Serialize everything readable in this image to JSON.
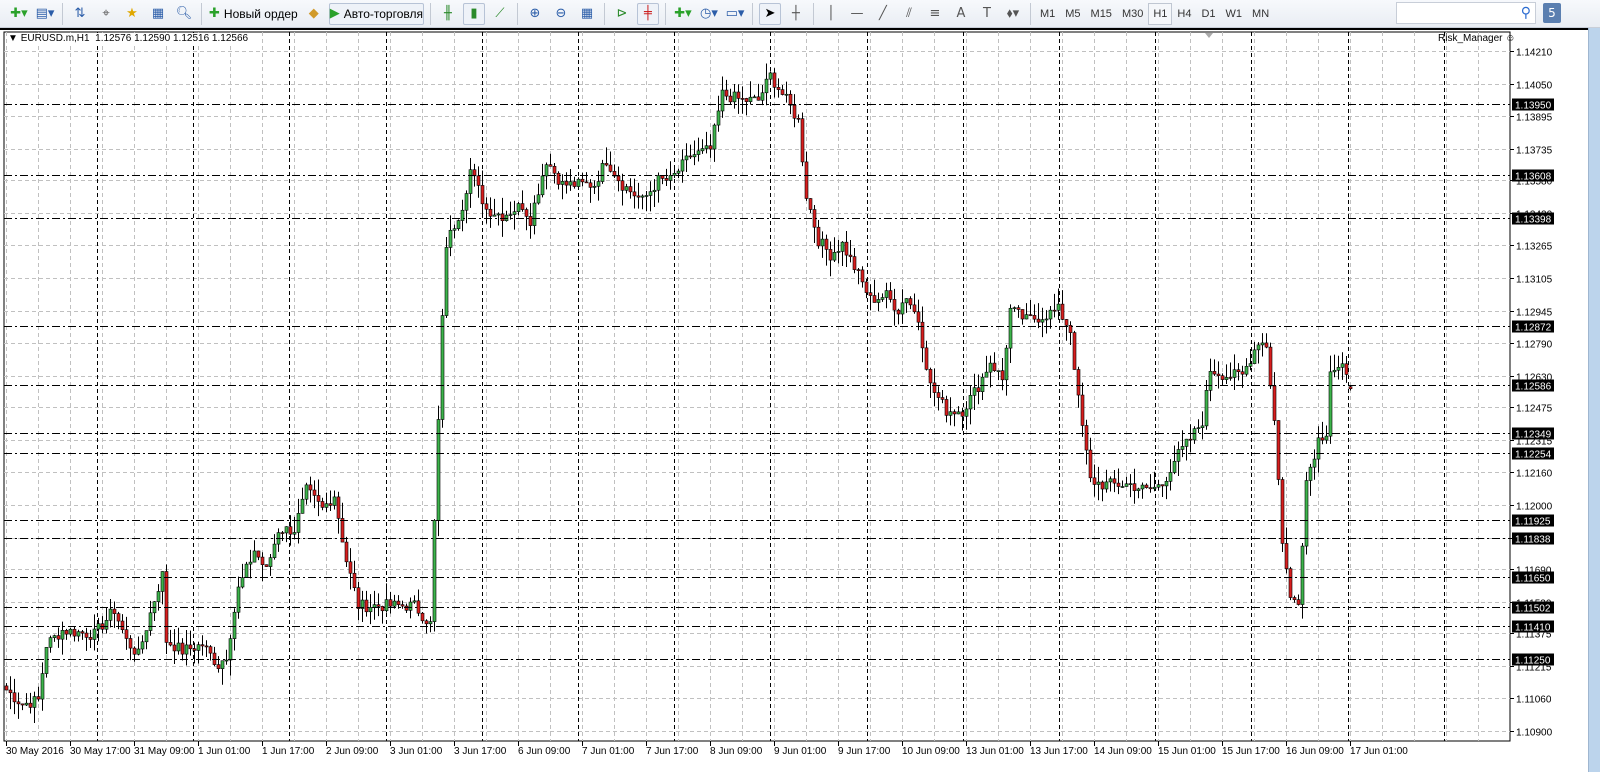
{
  "toolbar": {
    "new_order_label": "Новый ордер",
    "autotrading_label": "Авто-торговля",
    "icons": [
      "new-chart-icon",
      "profiles-icon",
      "market-watch-icon",
      "navigator-crosshair-icon",
      "favorites-icon",
      "terminal-icon",
      "strategy-tester-icon",
      "new-order-icon",
      "metaeditor-icon",
      "autotrading-icon",
      "bar-chart-icon",
      "candlestick-icon",
      "line-chart-icon",
      "zoom-in-icon",
      "zoom-out-icon",
      "tile-windows-icon",
      "chart-shift-icon",
      "autoscroll-icon",
      "indicators-icon",
      "periods-icon",
      "templates-icon",
      "cursor-icon",
      "crosshair-icon",
      "vertical-line-icon",
      "horizontal-line-icon",
      "trendline-icon",
      "equidistant-channel-icon",
      "fibonacci-icon",
      "text-icon",
      "text-label-icon",
      "arrows-icon"
    ],
    "timeframes": [
      "M1",
      "M5",
      "M15",
      "M30",
      "H1",
      "H4",
      "D1",
      "W1",
      "MN"
    ],
    "active_timeframe": "H1",
    "notification_count": "5"
  },
  "chart": {
    "symbol_line": "EURUSD.m,H1  1.12576 1.12590 1.12516 1.12566",
    "expert_label": "Risk_Manager",
    "colors": {
      "bull": "#3cb44b",
      "bear": "#d81e1e",
      "grid": "#c0c0c0",
      "level": "#000000"
    }
  },
  "chart_data": {
    "type": "candlestick",
    "symbol": "EURUSD.m",
    "timeframe": "H1",
    "ylim": [
      1.109,
      1.1421
    ],
    "y_ticks": [
      "1.14210",
      "1.14050",
      "1.13895",
      "1.13735",
      "1.13580",
      "1.13420",
      "1.13265",
      "1.13105",
      "1.12945",
      "1.12790",
      "1.12630",
      "1.12475",
      "1.12315",
      "1.12160",
      "1.12000",
      "1.11840",
      "1.11690",
      "1.11530",
      "1.11375",
      "1.11215",
      "1.11060",
      "1.10900"
    ],
    "levels": [
      "1.13950",
      "1.13608",
      "1.13398",
      "1.12872",
      "1.12586",
      "1.12349",
      "1.12254",
      "1.11925",
      "1.11838",
      "1.11650",
      "1.11502",
      "1.11410",
      "1.11250"
    ],
    "x_labels": [
      "30 May 2016",
      "30 May 17:00",
      "31 May 09:00",
      "1 Jun 01:00",
      "1 Jun 17:00",
      "2 Jun 09:00",
      "3 Jun 01:00",
      "3 Jun 17:00",
      "6 Jun 09:00",
      "7 Jun 01:00",
      "7 Jun 17:00",
      "8 Jun 09:00",
      "9 Jun 01:00",
      "9 Jun 17:00",
      "10 Jun 09:00",
      "13 Jun 01:00",
      "13 Jun 17:00",
      "14 Jun 09:00",
      "15 Jun 01:00",
      "15 Jun 17:00",
      "16 Jun 09:00",
      "17 Jun 01:00"
    ],
    "last_ohlc": {
      "open": 1.12576,
      "high": 1.1259,
      "low": 1.12516,
      "close": 1.12566
    },
    "close_path": [
      [
        0,
        1.111
      ],
      [
        4,
        1.1103
      ],
      [
        8,
        1.1105
      ],
      [
        10,
        1.1132
      ],
      [
        14,
        1.1139
      ],
      [
        22,
        1.1137
      ],
      [
        27,
        1.1149
      ],
      [
        30,
        1.1134
      ],
      [
        33,
        1.1127
      ],
      [
        37,
        1.1154
      ],
      [
        39,
        1.1166
      ],
      [
        40,
        1.1134
      ],
      [
        44,
        1.1129
      ],
      [
        49,
        1.1132
      ],
      [
        53,
        1.1122
      ],
      [
        55,
        1.1127
      ],
      [
        58,
        1.1159
      ],
      [
        62,
        1.1178
      ],
      [
        65,
        1.1168
      ],
      [
        68,
        1.1188
      ],
      [
        72,
        1.1188
      ],
      [
        75,
        1.1207
      ],
      [
        79,
        1.1198
      ],
      [
        82,
        1.1205
      ],
      [
        85,
        1.1173
      ],
      [
        88,
        1.1151
      ],
      [
        93,
        1.1151
      ],
      [
        98,
        1.1151
      ],
      [
        102,
        1.1151
      ],
      [
        106,
        1.1142
      ],
      [
        109,
        1.129
      ],
      [
        110,
        1.1327
      ],
      [
        114,
        1.1346
      ],
      [
        116,
        1.1363
      ],
      [
        120,
        1.1344
      ],
      [
        124,
        1.1341
      ],
      [
        129,
        1.1346
      ],
      [
        131,
        1.1339
      ],
      [
        135,
        1.1368
      ],
      [
        139,
        1.1356
      ],
      [
        143,
        1.1356
      ],
      [
        147,
        1.1356
      ],
      [
        150,
        1.1368
      ],
      [
        154,
        1.1356
      ],
      [
        159,
        1.1348
      ],
      [
        163,
        1.1358
      ],
      [
        166,
        1.1358
      ],
      [
        171,
        1.137
      ],
      [
        176,
        1.1373
      ],
      [
        179,
        1.14
      ],
      [
        184,
        1.1397
      ],
      [
        188,
        1.1397
      ],
      [
        191,
        1.1409
      ],
      [
        195,
        1.1397
      ],
      [
        198,
        1.1387
      ],
      [
        200,
        1.1351
      ],
      [
        203,
        1.1329
      ],
      [
        206,
        1.1322
      ],
      [
        209,
        1.1327
      ],
      [
        213,
        1.1312
      ],
      [
        216,
        1.13
      ],
      [
        220,
        1.1302
      ],
      [
        223,
        1.1295
      ],
      [
        225,
        1.1302
      ],
      [
        228,
        1.129
      ],
      [
        231,
        1.1258
      ],
      [
        235,
        1.1246
      ],
      [
        239,
        1.1246
      ],
      [
        243,
        1.1258
      ],
      [
        246,
        1.127
      ],
      [
        249,
        1.1261
      ],
      [
        251,
        1.1295
      ],
      [
        255,
        1.129
      ],
      [
        259,
        1.1292
      ],
      [
        263,
        1.1295
      ],
      [
        266,
        1.1285
      ],
      [
        268,
        1.1251
      ],
      [
        271,
        1.1212
      ],
      [
        274,
        1.121
      ],
      [
        278,
        1.121
      ],
      [
        281,
        1.121
      ],
      [
        285,
        1.1207
      ],
      [
        289,
        1.121
      ],
      [
        292,
        1.1222
      ],
      [
        296,
        1.1232
      ],
      [
        299,
        1.1241
      ],
      [
        301,
        1.1266
      ],
      [
        305,
        1.1263
      ],
      [
        309,
        1.1263
      ],
      [
        313,
        1.128
      ],
      [
        315,
        1.1278
      ],
      [
        317,
        1.1241
      ],
      [
        319,
        1.1183
      ],
      [
        321,
        1.1154
      ],
      [
        323,
        1.1154
      ],
      [
        325,
        1.1212
      ],
      [
        328,
        1.1232
      ],
      [
        330,
        1.1236
      ],
      [
        331,
        1.1266
      ],
      [
        334,
        1.1266
      ],
      [
        336,
        1.12566
      ]
    ]
  }
}
